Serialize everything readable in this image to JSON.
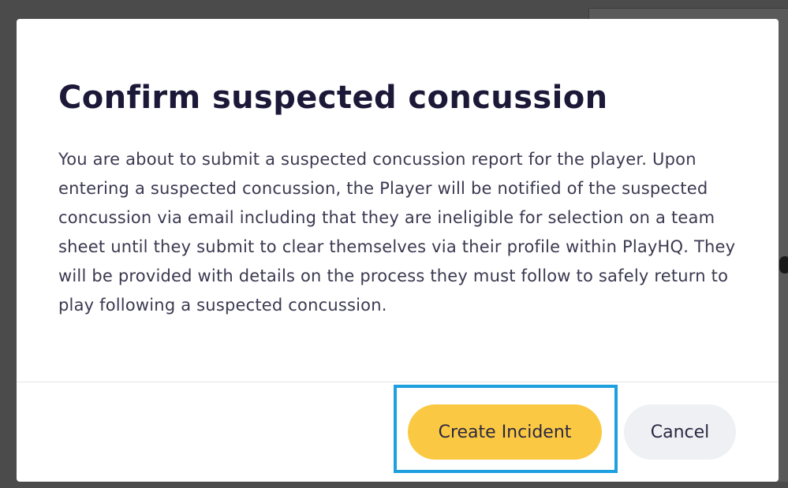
{
  "modal": {
    "title": "Confirm suspected concussion",
    "body": "You are about to submit a suspected concussion report for the player. Upon entering a suspected concussion, the Player will be notified of the suspected concussion via email including that they are ineligible for selection on a team sheet until they submit to clear themselves via their profile within PlayHQ. They will be provided with details on the process they must follow to safely return to play following a suspected concussion.",
    "primary_button_label": "Create Incident",
    "secondary_button_label": "Cancel"
  },
  "colors": {
    "primary_button": "#fbc843",
    "secondary_button": "#eef0f4",
    "highlight_border": "#1ea0df",
    "title_text": "#1c1838"
  }
}
